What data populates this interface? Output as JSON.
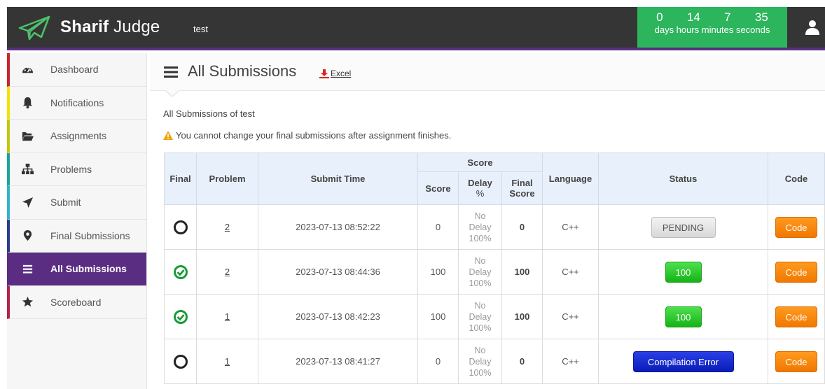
{
  "header": {
    "brand_bold": "Sharif",
    "brand_rest": " Judge",
    "username": "test",
    "countdown": {
      "days": "0",
      "hours": "14",
      "minutes": "7",
      "seconds": "35",
      "labels": "days hours minutes seconds"
    }
  },
  "sidebar": {
    "items": [
      {
        "label": "Dashboard",
        "icon": "dashboard-icon",
        "color": "#c9252c"
      },
      {
        "label": "Notifications",
        "icon": "bell-icon",
        "color": "#f2e200"
      },
      {
        "label": "Assignments",
        "icon": "folder-open-icon",
        "color": "#c4c80f"
      },
      {
        "label": "Problems",
        "icon": "sitemap-icon",
        "color": "#1ba49a"
      },
      {
        "label": "Submit",
        "icon": "send-icon",
        "color": "#35b2cc"
      },
      {
        "label": "Final Submissions",
        "icon": "map-marker-icon",
        "color": "#2a3d8c"
      },
      {
        "label": "All Submissions",
        "icon": "list-icon",
        "color": "#5a2d82"
      },
      {
        "label": "Scoreboard",
        "icon": "star-icon",
        "color": "#b5224b"
      }
    ]
  },
  "page": {
    "title": "All Submissions",
    "excel_label": "Excel",
    "subtitle": "All Submissions of test",
    "warning": "You cannot change your final submissions after assignment finishes."
  },
  "table": {
    "headers": {
      "final": "Final",
      "problem": "Problem",
      "submit_time": "Submit Time",
      "score_group": "Score",
      "score": "Score",
      "delay_top": "Delay",
      "delay_bottom": "%",
      "final_score_top": "Final",
      "final_score_bottom": "Score",
      "language": "Language",
      "status": "Status",
      "code": "Code"
    },
    "rows": [
      {
        "final": false,
        "problem": "2",
        "submit_time": "2023-07-13 08:52:22",
        "score": "0",
        "delay_1": "No",
        "delay_2": "Delay",
        "delay_3": "100%",
        "final_score": "0",
        "language": "C++",
        "status": "PENDING",
        "status_type": "pending",
        "code": "Code"
      },
      {
        "final": true,
        "problem": "2",
        "submit_time": "2023-07-13 08:44:36",
        "score": "100",
        "delay_1": "No",
        "delay_2": "Delay",
        "delay_3": "100%",
        "final_score": "100",
        "language": "C++",
        "status": "100",
        "status_type": "score",
        "code": "Code"
      },
      {
        "final": true,
        "problem": "1",
        "submit_time": "2023-07-13 08:42:23",
        "score": "100",
        "delay_1": "No",
        "delay_2": "Delay",
        "delay_3": "100%",
        "final_score": "100",
        "language": "C++",
        "status": "100",
        "status_type": "score",
        "code": "Code"
      },
      {
        "final": false,
        "problem": "1",
        "submit_time": "2023-07-13 08:41:27",
        "score": "0",
        "delay_1": "No",
        "delay_2": "Delay",
        "delay_3": "100%",
        "final_score": "0",
        "language": "C++",
        "status": "Compilation Error",
        "status_type": "error",
        "code": "Code"
      }
    ]
  },
  "colors": {
    "accent": "#5a2d82",
    "countdown_bg": "#2db55d",
    "final_check": "#1a9a3a"
  }
}
